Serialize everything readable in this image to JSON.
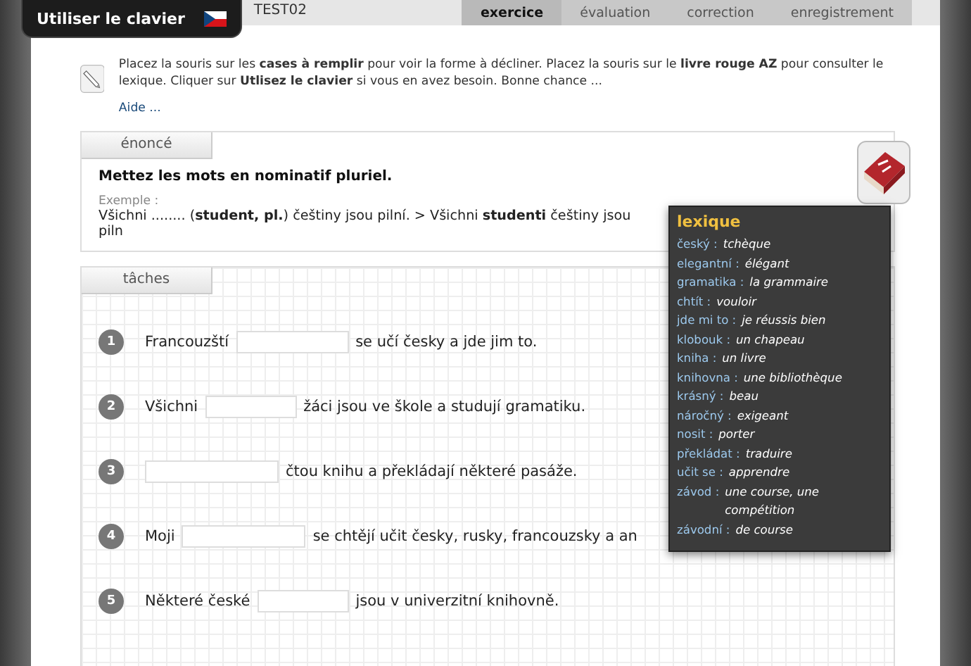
{
  "header": {
    "title": "TEST02",
    "keyboard_button": "Utiliser le clavier",
    "steps": [
      {
        "label": "exercice",
        "selected": true
      },
      {
        "label": "évaluation",
        "selected": false
      },
      {
        "label": "correction",
        "selected": false
      },
      {
        "label": "enregistrement",
        "selected": false
      }
    ]
  },
  "intro": {
    "text": "Placez la souris sur les **cases à remplir** pour voir la forme à décliner. Placez la souris sur le **livre rouge AZ** pour consulter le lexique. Cliquer sur **Utlisez le clavier** si vous en avez besoin. Bonne chance ...",
    "help_link": "Aide ..."
  },
  "statement": {
    "tab": "énoncé",
    "instruction": "Mettez les mots en nominatif pluriel.",
    "example_label": "Exemple :",
    "example": "Všichni ........ (**student, pl.**) češtiny jsou pilní. > Všichni **studenti** češtiny jsou piln"
  },
  "tasks": {
    "tab": "tâches",
    "items": [
      {
        "number": "1",
        "before": "Francouzští",
        "after": "se učí česky a jde jim to."
      },
      {
        "number": "2",
        "before": "Všichni",
        "after": "žáci jsou ve škole a studují gramatiku."
      },
      {
        "number": "3",
        "after": "čtou knihu a překládají některé pasáže."
      },
      {
        "number": "4",
        "before": "Moji",
        "after": "se chtějí učit česky, rusky, francouzsky a an"
      },
      {
        "number": "5",
        "before": "Některé české",
        "after": "jsou v univerzitní knihovně."
      }
    ]
  },
  "lexique": {
    "title": "lexique",
    "entries": [
      {
        "term": "český :",
        "translation": "tchèque"
      },
      {
        "term": "elegantní :",
        "translation": "élégant"
      },
      {
        "term": "gramatika :",
        "translation": "la grammaire"
      },
      {
        "term": "chtít :",
        "translation": "vouloir"
      },
      {
        "term": "jde mi to :",
        "translation": "je réussis bien"
      },
      {
        "term": "klobouk :",
        "translation": "un chapeau"
      },
      {
        "term": "kniha :",
        "translation": "un livre"
      },
      {
        "term": "knihovna :",
        "translation": "une bibliothèque"
      },
      {
        "term": "krásný :",
        "translation": "beau"
      },
      {
        "term": "náročný :",
        "translation": "exigeant"
      },
      {
        "term": "nosit :",
        "translation": "porter"
      },
      {
        "term": "překládat :",
        "translation": "traduire"
      },
      {
        "term": "učit se :",
        "translation": "apprendre"
      },
      {
        "term": "závod :",
        "translation": "une course, une compétition"
      },
      {
        "term": "závodní :",
        "translation": "de course"
      }
    ]
  }
}
